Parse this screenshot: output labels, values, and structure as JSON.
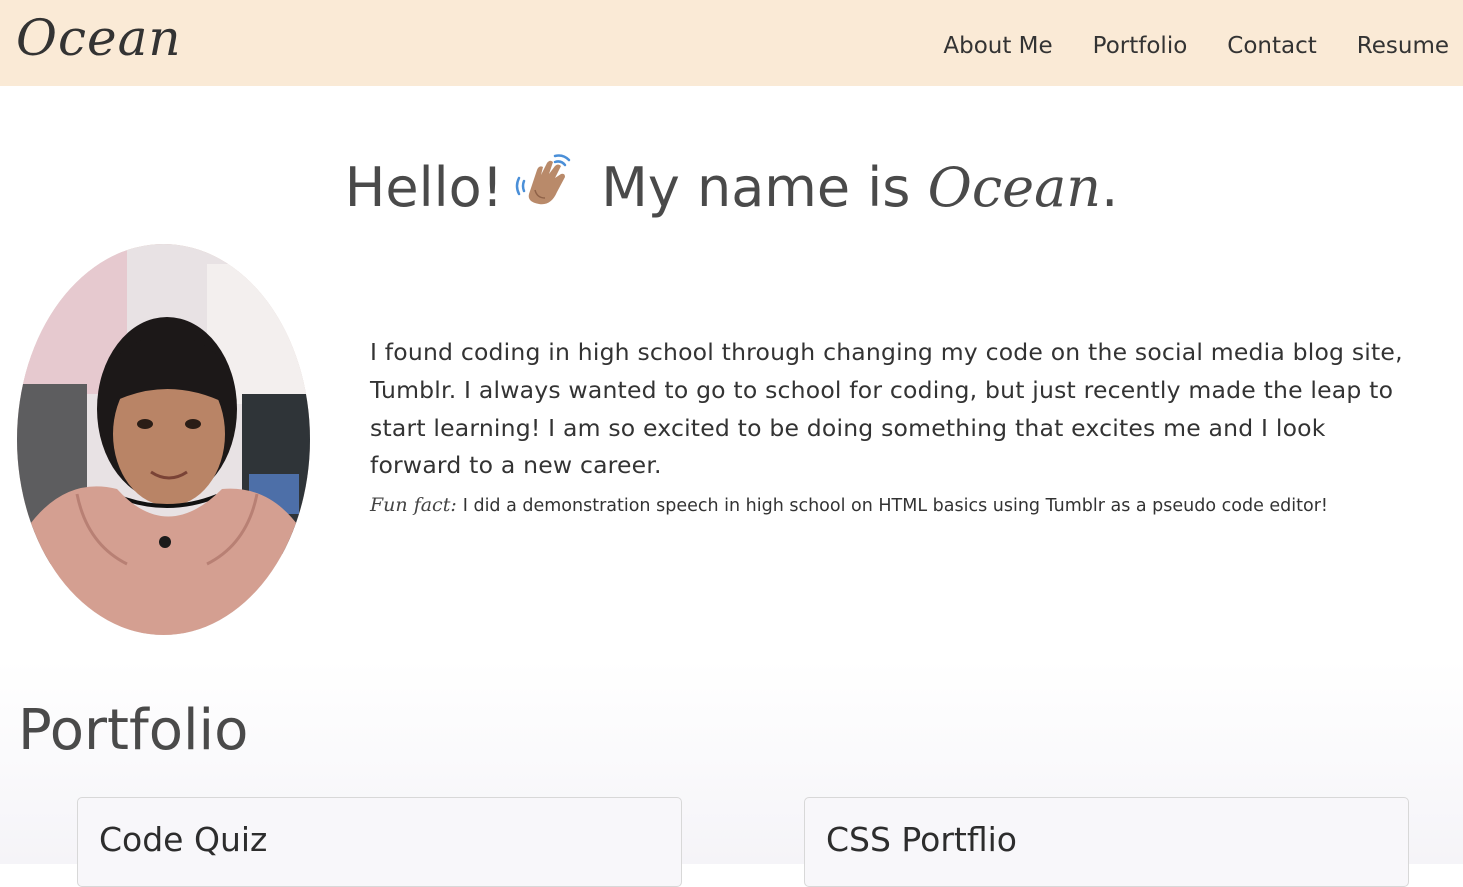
{
  "navbar": {
    "brand": "Ocean",
    "links": [
      {
        "label": "About Me"
      },
      {
        "label": "Portfolio"
      },
      {
        "label": "Contact"
      },
      {
        "label": "Resume"
      }
    ]
  },
  "about": {
    "greeting": "Hello!",
    "wave_icon": "waving-hand-icon",
    "name_prefix": "My name is",
    "name": "Ocean",
    "name_suffix": ".",
    "bio": "I found coding in high school through changing my code on the social media blog site, Tumblr. I always wanted to go to school for coding, but just recently made the leap to start learning! I am so excited to be doing something that excites me and I look forward to a new career.",
    "fun_fact_label": "Fun fact:",
    "fun_fact": "I did a demonstration speech in high school on HTML basics using Tumblr as a pseudo code editor!"
  },
  "portfolio": {
    "title": "Portfolio",
    "cards": [
      {
        "title": "Code Quiz"
      },
      {
        "title": "CSS Portflio"
      }
    ]
  },
  "colors": {
    "navbar_bg": "#faead6",
    "text": "#333333",
    "heading": "#4a4a4a"
  }
}
